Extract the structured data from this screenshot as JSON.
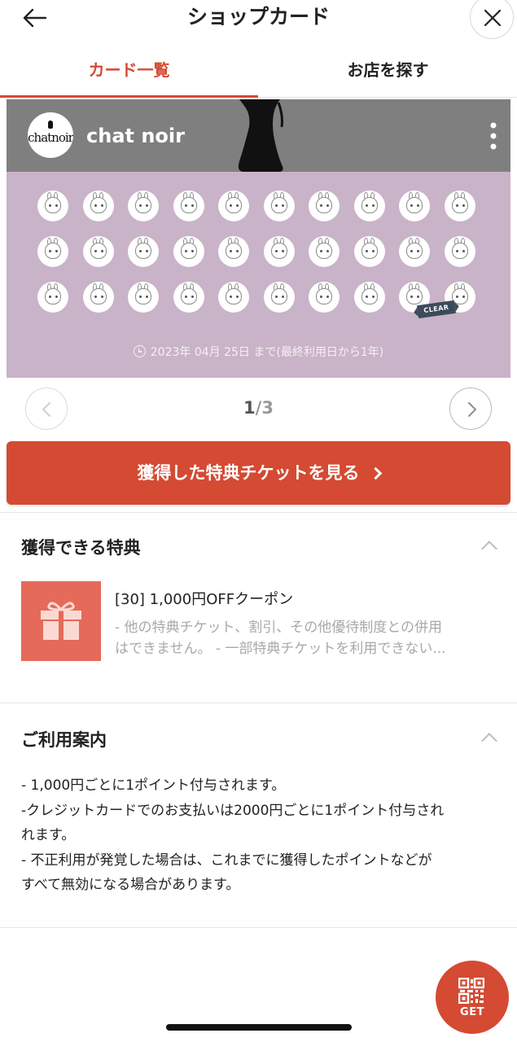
{
  "header": {
    "title": "ショップカード",
    "back_icon": "arrow-left-icon",
    "close_icon": "close-icon"
  },
  "tabs": [
    {
      "label": "カード一覧",
      "active": true
    },
    {
      "label": "お店を探す",
      "active": false
    }
  ],
  "card": {
    "shop_name": "chat noir",
    "logo_text": "chatnoir",
    "header_color": "#7f7f7f",
    "background_color": "#c9b3c8",
    "stamps_collected": 30,
    "stamps_total": 30,
    "clear_badge": "CLEAR",
    "expiry_text": "2023年 04月 25日 まで(最終利用日から1年)"
  },
  "pager": {
    "current": "1",
    "separator": "/",
    "total": "3"
  },
  "cta": {
    "label": "獲得した特典チケットを見る"
  },
  "benefits": {
    "title": "獲得できる特典",
    "items": [
      {
        "title": "[30] 1,000円OFFクーポン",
        "desc_line1": "- 他の特典チケット、割引、その他優待制度との併用",
        "desc_line2": "はできません。 - 一部特典チケットを利用できない..."
      }
    ]
  },
  "guide": {
    "title": "ご利用案内",
    "lines": [
      "- 1,000円ごとに1ポイント付与されます。",
      "-クレジットカードでのお支払いは2000円ごとに1ポイント付与され",
      "れます。",
      "- 不正利用が発覚した場合は、これまでに獲得したポイントなどが",
      "すべて無効になる場合があります。"
    ]
  },
  "fab": {
    "label": "GET",
    "icon": "qr-code-icon"
  },
  "colors": {
    "accent": "#d44a33",
    "gift_tile": "#e56a5a"
  }
}
